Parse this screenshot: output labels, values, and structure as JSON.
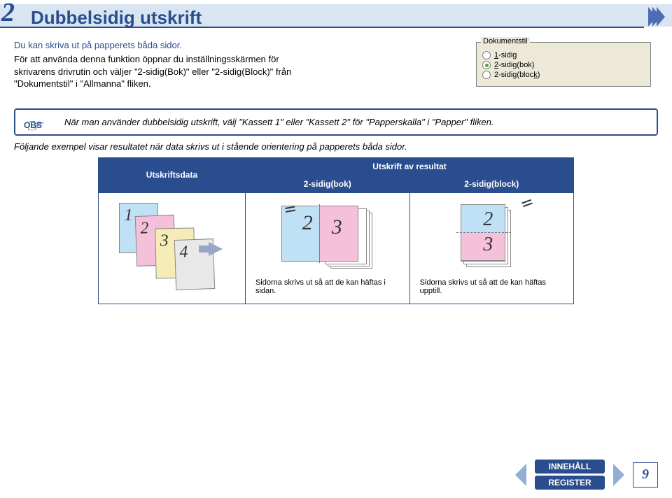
{
  "section_number": "2",
  "section_title": "Dubbelsidig utskrift",
  "intro_lead": "Du kan skriva ut på papperets båda sidor.",
  "intro_body": "För att använda denna funktion öppnar du inställningsskärmen för skrivarens drivrutin och väljer \"2-sidig(Bok)\" eller \"2-sidig(Block)\" från \"Dokumentstil\" i \"Allmanna\" fliken.",
  "dialog": {
    "group_label": "Dokumentstil",
    "options": [
      {
        "label_pre": "",
        "underline": "1",
        "label_post": "-sidig",
        "checked": false
      },
      {
        "label_pre": "",
        "underline": "2",
        "label_post": "-sidig(bok)",
        "checked": true
      },
      {
        "label_pre": "2-sidig(bloc",
        "underline": "k",
        "label_post": ")",
        "checked": false
      }
    ]
  },
  "note": {
    "obs_label": "OBS",
    "text": "När man använder dubbelsidig utskrift, välj \"Kassett 1\" eller \"Kassett 2\" för \"Papperskalla\" i \"Papper\" fliken."
  },
  "example_intro": "Följande exempel visar resultatet när data skrivs ut i stående orientering på papperets båda sidor.",
  "table": {
    "header_data": "Utskriftsdata",
    "header_result": "Utskrift av resultat",
    "header_bok": "2-sidig(bok)",
    "header_block": "2-sidig(block)",
    "sheets": [
      "1",
      "2",
      "3",
      "4"
    ],
    "bok_pages": [
      "2",
      "3"
    ],
    "block_pages": [
      "2",
      "3"
    ],
    "caption_bok": "Sidorna skrivs ut så att de kan häftas i sidan.",
    "caption_block": "Sidorna skrivs ut så att de kan häftas upptill."
  },
  "footer": {
    "innehall": "INNEHÅLL",
    "register": "REGISTER",
    "page_num": "9"
  }
}
